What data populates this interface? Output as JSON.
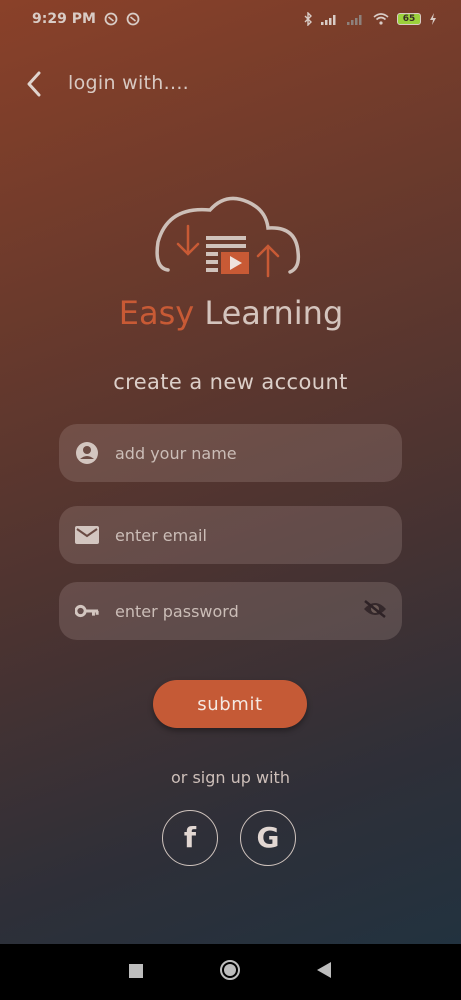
{
  "status_bar": {
    "time": "9:29 PM",
    "battery_level": "65",
    "left_icons": [
      "sync-icon",
      "sync-icon"
    ],
    "right_icons": [
      "bluetooth-icon",
      "signal-icon",
      "signal-icon",
      "wifi-icon",
      "battery-icon",
      "charging-icon"
    ]
  },
  "header": {
    "back_icon": "chevron-left-icon",
    "title": "login with...."
  },
  "logo": {
    "word_easy": "Easy",
    "word_learning": "Learning",
    "brand_color": "#c85a35"
  },
  "form": {
    "heading": "create a new account",
    "name_placeholder": "add your name",
    "name_value": "",
    "email_placeholder": "enter email",
    "email_value": "",
    "password_placeholder": "enter password",
    "password_value": "",
    "name_icon": "account-circle-icon",
    "email_icon": "mail-icon",
    "password_icon": "key-icon",
    "visibility_icon": "eye-off-icon",
    "submit_label": "submit"
  },
  "social": {
    "label": "or sign up with",
    "facebook_glyph": "f",
    "google_glyph": "G"
  },
  "colors": {
    "accent": "#c55a36",
    "gradient_top": "#8a4129",
    "gradient_bottom": "#22323f"
  },
  "nav_bar": {
    "icons": [
      "recents-square-icon",
      "home-circle-icon",
      "back-triangle-icon"
    ]
  }
}
